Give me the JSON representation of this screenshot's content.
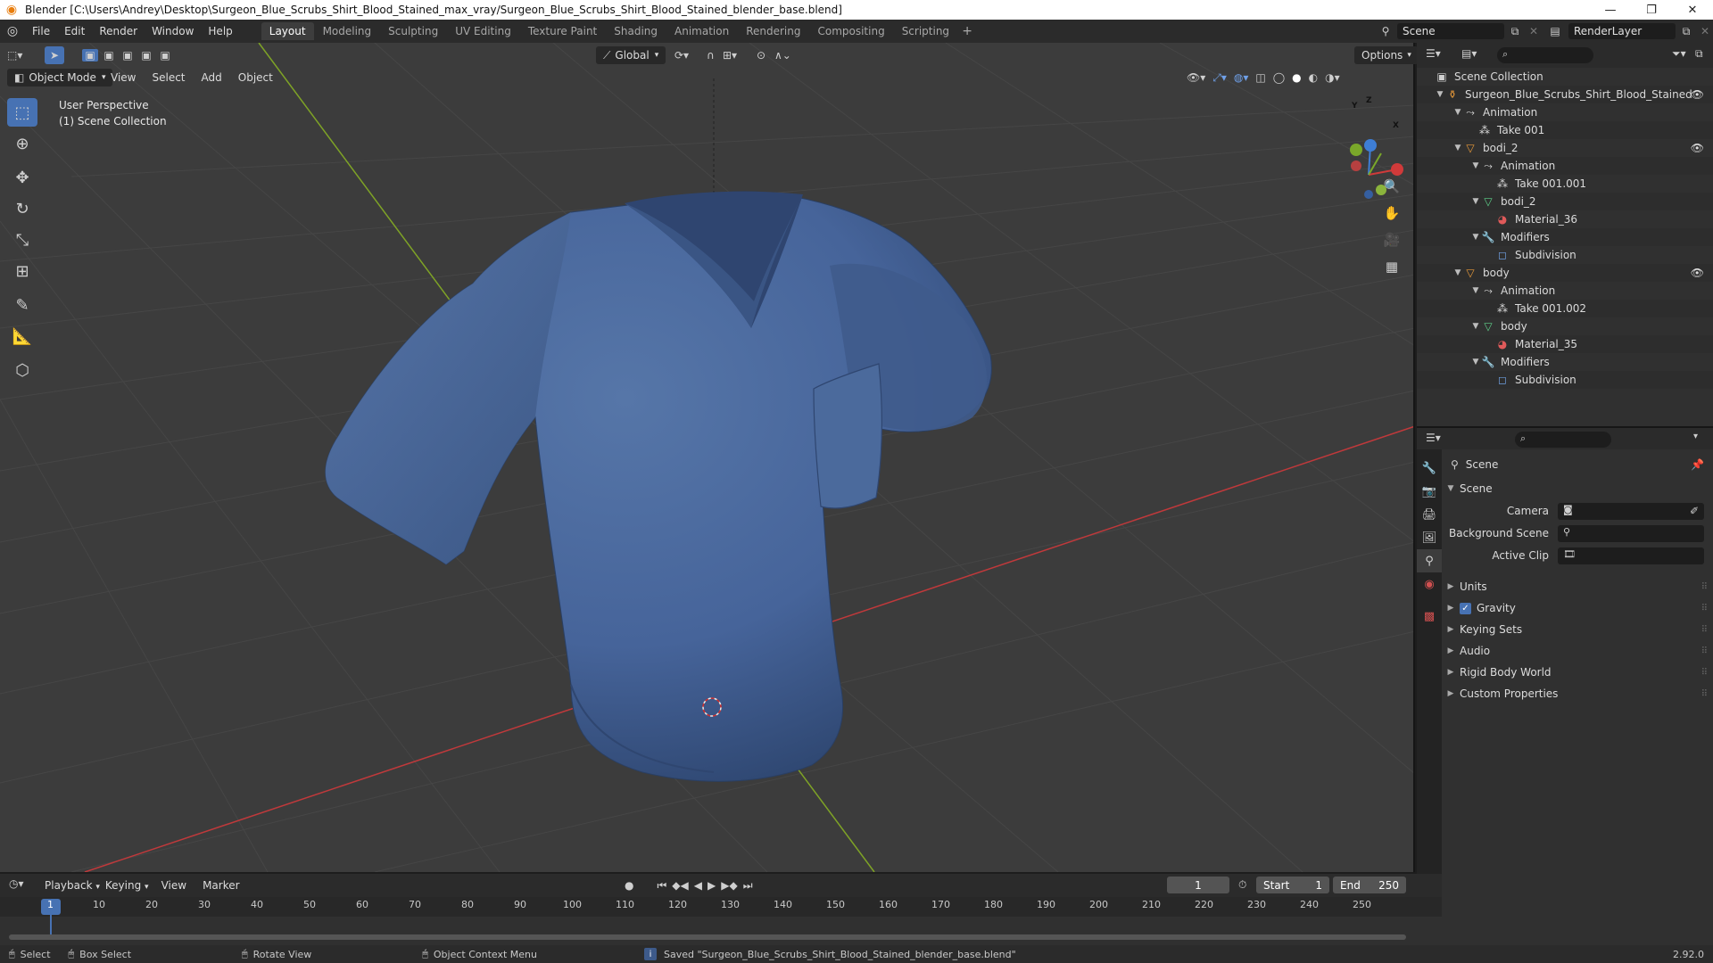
{
  "window": {
    "title": "Blender [C:\\Users\\Andrey\\Desktop\\Surgeon_Blue_Scrubs_Shirt_Blood_Stained_max_vray/Surgeon_Blue_Scrubs_Shirt_Blood_Stained_blender_base.blend]"
  },
  "menus": [
    "File",
    "Edit",
    "Render",
    "Window",
    "Help"
  ],
  "workspaces": [
    "Layout",
    "Modeling",
    "Sculpting",
    "UV Editing",
    "Texture Paint",
    "Shading",
    "Animation",
    "Rendering",
    "Compositing",
    "Scripting"
  ],
  "active_workspace": "Layout",
  "scene_field": "Scene",
  "renderlayer_field": "RenderLayer",
  "viewport": {
    "mode": "Object Mode",
    "menu": [
      "View",
      "Select",
      "Add",
      "Object"
    ],
    "transform": "Global",
    "options": "Options",
    "overlay_line1": "User Perspective",
    "overlay_line2": "(1) Scene Collection",
    "gizmo": {
      "x": "X",
      "y": "Y",
      "z": "Z"
    }
  },
  "outliner": {
    "root": "Scene Collection",
    "rows": [
      {
        "label": "Surgeon_Blue_Scrubs_Shirt_Blood_Stained",
        "icon": "object-icon"
      },
      {
        "label": "Animation",
        "icon": "animation-icon"
      },
      {
        "label": "Take 001",
        "icon": "action-icon"
      },
      {
        "label": "bodi_2",
        "icon": "mesh-object-icon"
      },
      {
        "label": "Animation",
        "icon": "animation-icon"
      },
      {
        "label": "Take 001.001",
        "icon": "action-icon"
      },
      {
        "label": "bodi_2",
        "icon": "mesh-data-icon"
      },
      {
        "label": "Material_36",
        "icon": "material-icon"
      },
      {
        "label": "Modifiers",
        "icon": "wrench-icon"
      },
      {
        "label": "Subdivision",
        "icon": "subdivision-icon"
      },
      {
        "label": "body",
        "icon": "mesh-object-icon"
      },
      {
        "label": "Animation",
        "icon": "animation-icon"
      },
      {
        "label": "Take 001.002",
        "icon": "action-icon"
      },
      {
        "label": "body",
        "icon": "mesh-data-icon"
      },
      {
        "label": "Material_35",
        "icon": "material-icon"
      },
      {
        "label": "Modifiers",
        "icon": "wrench-icon"
      },
      {
        "label": "Subdivision",
        "icon": "subdivision-icon"
      }
    ]
  },
  "properties": {
    "context": "Scene",
    "panel": "Scene",
    "camera_label": "Camera",
    "bg_scene_label": "Background Scene",
    "active_clip_label": "Active Clip",
    "sections": [
      "Units",
      "Gravity",
      "Keying Sets",
      "Audio",
      "Rigid Body World",
      "Custom Properties"
    ],
    "gravity_checked": true
  },
  "timeline": {
    "menu": [
      "Playback",
      "Keying",
      "View",
      "Marker"
    ],
    "current_frame": "1",
    "start_label": "Start",
    "start": "1",
    "end_label": "End",
    "end": "250",
    "ticks": [
      "1",
      "10",
      "20",
      "30",
      "40",
      "50",
      "60",
      "70",
      "80",
      "90",
      "100",
      "110",
      "120",
      "130",
      "140",
      "150",
      "160",
      "170",
      "180",
      "190",
      "200",
      "210",
      "220",
      "230",
      "240",
      "250"
    ]
  },
  "status": {
    "select": "Select",
    "box_select": "Box Select",
    "rotate_view": "Rotate View",
    "context_menu": "Object Context Menu",
    "message": "Saved \"Surgeon_Blue_Scrubs_Shirt_Blood_Stained_blender_base.blend\"",
    "version": "2.92.0"
  },
  "colors": {
    "accent": "#4772b3",
    "shirt": "#4a6898",
    "grid_x": "#c0393b",
    "grid_y": "#7ea326"
  }
}
